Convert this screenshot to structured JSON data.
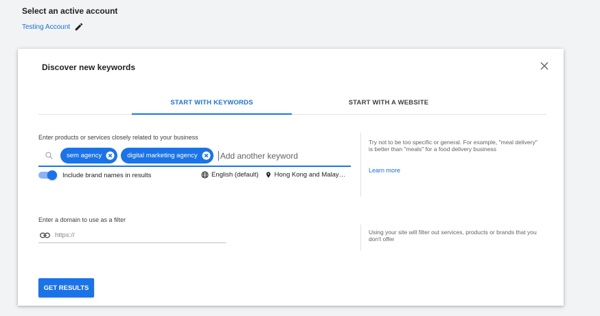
{
  "header": {
    "title": "Select an active account",
    "account_name": "Testing Account"
  },
  "dialog": {
    "title": "Discover new keywords",
    "tabs": [
      {
        "label": "START WITH KEYWORDS",
        "active": true
      },
      {
        "label": "START WITH A WEBSITE",
        "active": false
      }
    ],
    "keywords_section": {
      "label": "Enter products or services closely related to your business",
      "chips": [
        "sem agency",
        "digital marketing agency"
      ],
      "input_placeholder": "Add another keyword",
      "brand_toggle": {
        "label": "Include brand names in results",
        "on": true
      },
      "language": "English (default)",
      "location": "Hong Kong and Malay…",
      "hint": "Try not to be too specific or general. For example, \"meal delivery\" is better than \"meals\" for a food delivery business",
      "learn_more": "Learn more"
    },
    "domain_section": {
      "label": "Enter a domain to use as a filter",
      "placeholder": "https://",
      "hint": "Using your site will filter out services, products or brands that you don't offer"
    },
    "submit_label": "GET RESULTS"
  },
  "colors": {
    "accent": "#1a73e8",
    "background": "#f1f3f4",
    "text": "#202124",
    "muted": "#5f6368"
  }
}
